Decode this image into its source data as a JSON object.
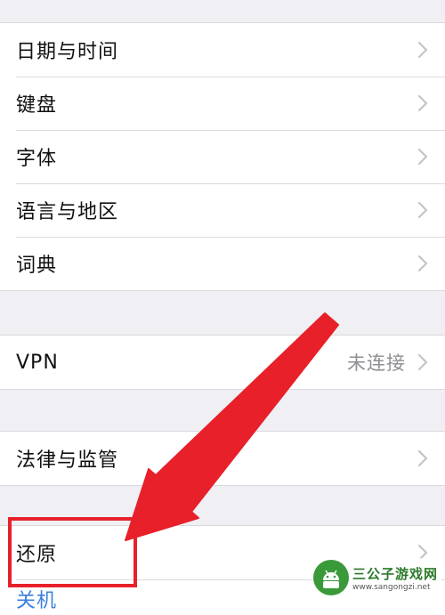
{
  "group1": {
    "items": [
      {
        "label": "日期与时间"
      },
      {
        "label": "键盘"
      },
      {
        "label": "字体"
      },
      {
        "label": "语言与地区"
      },
      {
        "label": "词典"
      }
    ]
  },
  "vpn": {
    "label": "VPN",
    "value": "未连接"
  },
  "legal": {
    "label": "法律与监管"
  },
  "reset": {
    "label": "还原"
  },
  "partial": {
    "label": "关机"
  },
  "watermark": {
    "title": "三公子游戏网",
    "url": "www.sangongzi.net"
  },
  "colors": {
    "arrow": "#e8202a",
    "highlight": "#e8202a",
    "background": "#efeff4",
    "chevron": "#c4c4c8"
  }
}
